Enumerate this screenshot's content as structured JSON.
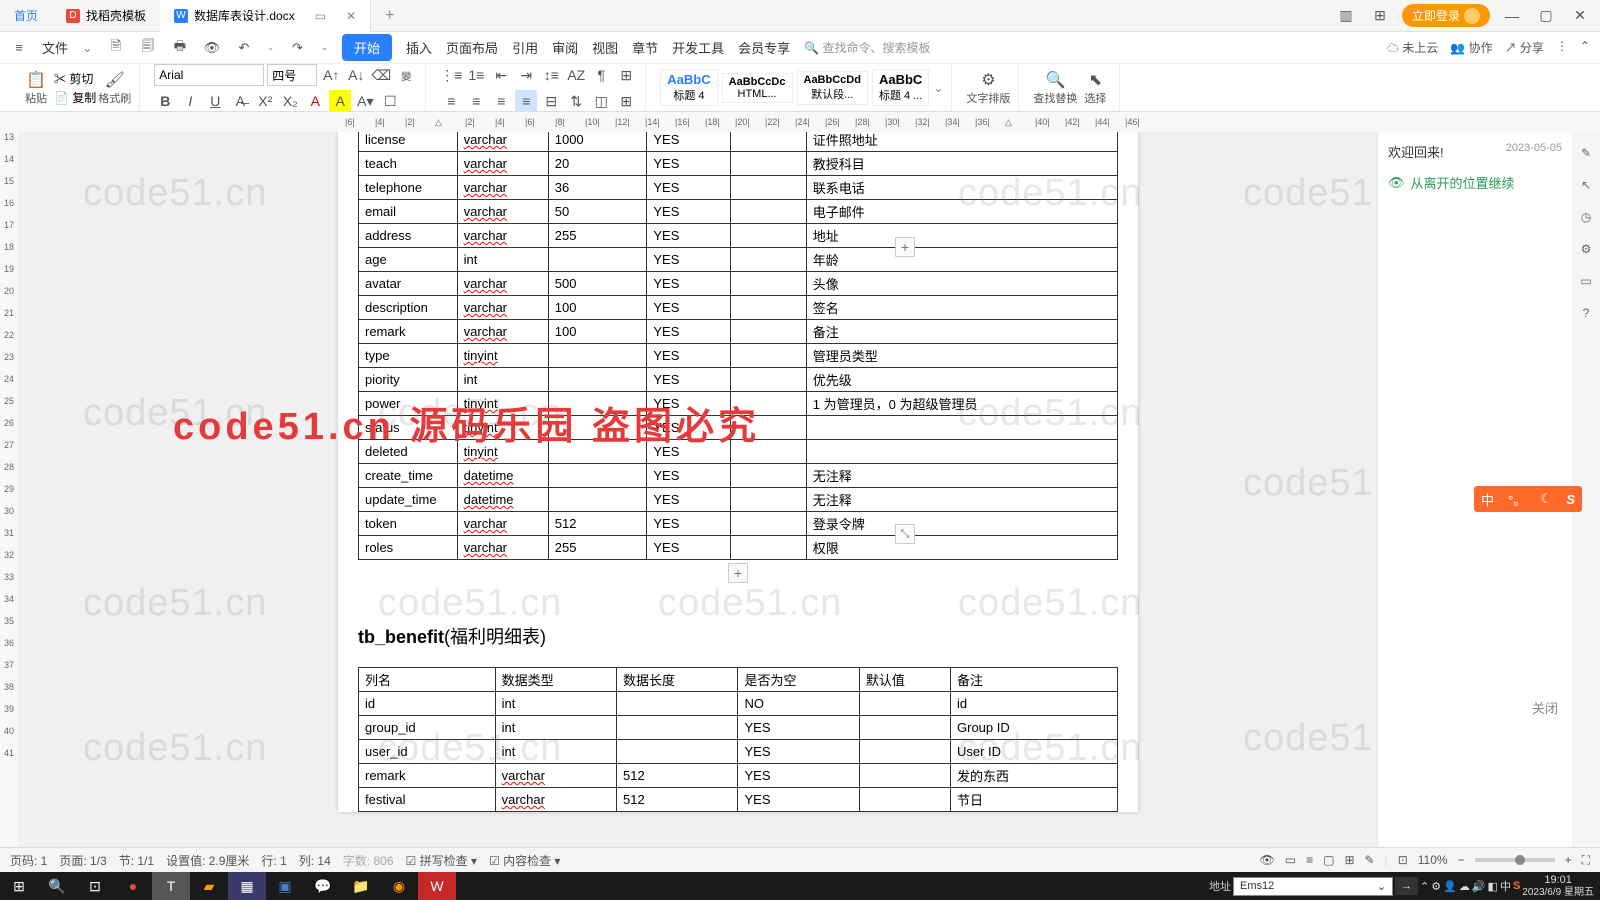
{
  "tabs": {
    "home": "首页",
    "template": "找稻壳模板",
    "doc": "数据库表设计.docx",
    "add": "+"
  },
  "title_right": {
    "login": "立即登录"
  },
  "menubar": {
    "file": "文件",
    "start": "开始",
    "insert": "插入",
    "layout": "页面布局",
    "ref": "引用",
    "review": "审阅",
    "view": "视图",
    "chapter": "章节",
    "dev": "开发工具",
    "member": "会员专享",
    "search": "查找命令、搜索模板",
    "cloud": "未上云",
    "collab": "协作",
    "share": "分享"
  },
  "toolbar": {
    "paste": "粘贴",
    "cut": "剪切",
    "copy": "复制",
    "brush": "格式刷",
    "font": "Arial",
    "size": "四号",
    "styles": [
      "标题 4",
      "HTML...",
      "默认段...",
      "标题 4 ...",
      ""
    ],
    "style_prev": [
      "AaBbC",
      "AaBbCcDc",
      "AaBbCcDd",
      "AaBbC"
    ],
    "typeset": "文字排版",
    "findrep": "查找替换",
    "select": "选择"
  },
  "table1": [
    [
      "license",
      "varchar",
      "1000",
      "YES",
      "",
      "证件照地址"
    ],
    [
      "teach",
      "varchar",
      "20",
      "YES",
      "",
      "教授科目"
    ],
    [
      "telephone",
      "varchar",
      "36",
      "YES",
      "",
      "联系电话"
    ],
    [
      "email",
      "varchar",
      "50",
      "YES",
      "",
      "电子邮件"
    ],
    [
      "address",
      "varchar",
      "255",
      "YES",
      "",
      "地址"
    ],
    [
      "age",
      "int",
      "",
      "YES",
      "",
      "年龄"
    ],
    [
      "avatar",
      "varchar",
      "500",
      "YES",
      "",
      "头像"
    ],
    [
      "description",
      "varchar",
      "100",
      "YES",
      "",
      "签名"
    ],
    [
      "remark",
      "varchar",
      "100",
      "YES",
      "",
      "备注"
    ],
    [
      "type",
      "tinyint",
      "",
      "YES",
      "",
      "管理员类型"
    ],
    [
      "piority",
      "int",
      "",
      "YES",
      "",
      "优先级"
    ],
    [
      "power",
      "tinyint",
      "",
      "YES",
      "",
      "1 为管理员，0 为超级管理员"
    ],
    [
      "status",
      "tinyint",
      "",
      "YES",
      "",
      ""
    ],
    [
      "deleted",
      "tinyint",
      "",
      "YES",
      "",
      ""
    ],
    [
      "create_time",
      "datetime",
      "",
      "YES",
      "",
      "无注释"
    ],
    [
      "update_time",
      "datetime",
      "",
      "YES",
      "",
      "无注释"
    ],
    [
      "token",
      "varchar",
      "512",
      "YES",
      "",
      "登录令牌"
    ],
    [
      "roles",
      "varchar",
      "255",
      "YES",
      "",
      "权限"
    ]
  ],
  "heading2": {
    "name": "tb_benefit",
    "desc": "(福利明细表)"
  },
  "table2_head": [
    "列名",
    "数据类型",
    "数据长度",
    "是否为空",
    "默认值",
    "备注"
  ],
  "table2": [
    [
      "id",
      "int",
      "",
      "NO",
      "",
      "id"
    ],
    [
      "group_id",
      "int",
      "",
      "YES",
      "",
      "Group ID"
    ],
    [
      "user_id",
      "int",
      "",
      "YES",
      "",
      "User ID"
    ],
    [
      "remark",
      "varchar",
      "512",
      "YES",
      "",
      "发的东西"
    ],
    [
      "festival",
      "varchar",
      "512",
      "YES",
      "",
      "节日"
    ]
  ],
  "side": {
    "welcome": "欢迎回来!",
    "date": "2023-05-05",
    "resume": "从离开的位置继续",
    "close": "关闭"
  },
  "status": {
    "page": "页码: 1",
    "pages": "页面: 1/3",
    "sec": "节: 1/1",
    "setting": "设置值: 2.9厘米",
    "row": "行: 1",
    "col": "列: 14",
    "words": "字数: 806",
    "spell": "拼写检查",
    "content": "内容检查",
    "zoom": "110%"
  },
  "taskbar": {
    "addr_label": "地址",
    "addr": "Ems12",
    "time": "19:01",
    "date": "2023/6/9 星期五"
  },
  "vruler": [
    "13",
    "14",
    "15",
    "16",
    "17",
    "18",
    "19",
    "20",
    "21",
    "22",
    "23",
    "24",
    "25",
    "26",
    "27",
    "28",
    "29",
    "30",
    "31",
    "32",
    "33",
    "34",
    "35",
    "36",
    "37",
    "38",
    "39",
    "40",
    "41"
  ],
  "hruler": [
    "|6|",
    "|4|",
    "|2|",
    "△",
    "|2|",
    "|4|",
    "|6|",
    "|8|",
    "|10|",
    "|12|",
    "|14|",
    "|16|",
    "|18|",
    "|20|",
    "|22|",
    "|24|",
    "|26|",
    "|28|",
    "|30|",
    "|32|",
    "|34|",
    "|36|",
    "△",
    "|40|",
    "|42|",
    "|44|",
    "|46|"
  ],
  "wm": "code51.cn",
  "wm_red": "code51.cn 源码乐园 盗图必究",
  "ime": {
    "zh": "中",
    "ring": "°。",
    "s": "S"
  }
}
